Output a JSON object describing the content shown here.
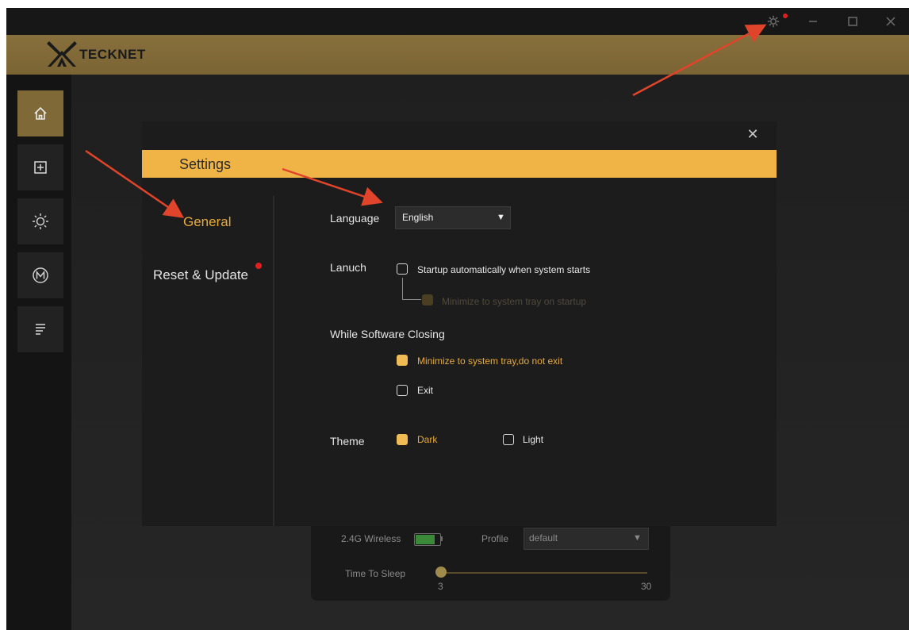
{
  "brand": {
    "name": "TECKNET"
  },
  "window_controls": {
    "settings_icon": "gear-icon",
    "minimize_icon": "minimize-icon",
    "maximize_icon": "maximize-icon",
    "close_icon": "close-icon"
  },
  "nav": {
    "items": [
      {
        "icon": "home-icon",
        "active": true
      },
      {
        "icon": "plus-box-icon",
        "active": false
      },
      {
        "icon": "sun-icon",
        "active": false
      },
      {
        "icon": "macro-m-icon",
        "active": false
      },
      {
        "icon": "list-icon",
        "active": false
      }
    ]
  },
  "device_card": {
    "connection_label": "2.4G Wireless",
    "battery_level": 0.8,
    "profile_label": "Profile",
    "profile_value": "default",
    "sleep_label": "Time To Sleep",
    "sleep_min": "3",
    "sleep_max": "30",
    "sleep_value": 3
  },
  "dialog": {
    "title": "Settings",
    "sidebar": {
      "general": "General",
      "reset_update": "Reset & Update"
    },
    "language": {
      "label": "Language",
      "value": "English"
    },
    "launch": {
      "label": "Lanuch",
      "startup_option": "Startup automatically when system starts",
      "minimize_option": "Minimize to system tray on startup"
    },
    "closing": {
      "label": "While Software Closing",
      "minimize_option": "Minimize to system tray,do not exit",
      "exit_option": "Exit"
    },
    "theme": {
      "label": "Theme",
      "dark": "Dark",
      "light": "Light"
    }
  },
  "colors": {
    "accent": "#efb445",
    "brand_bar": "#87703c",
    "annotation_arrow": "#e0442a",
    "notification_dot": "#e02020"
  }
}
